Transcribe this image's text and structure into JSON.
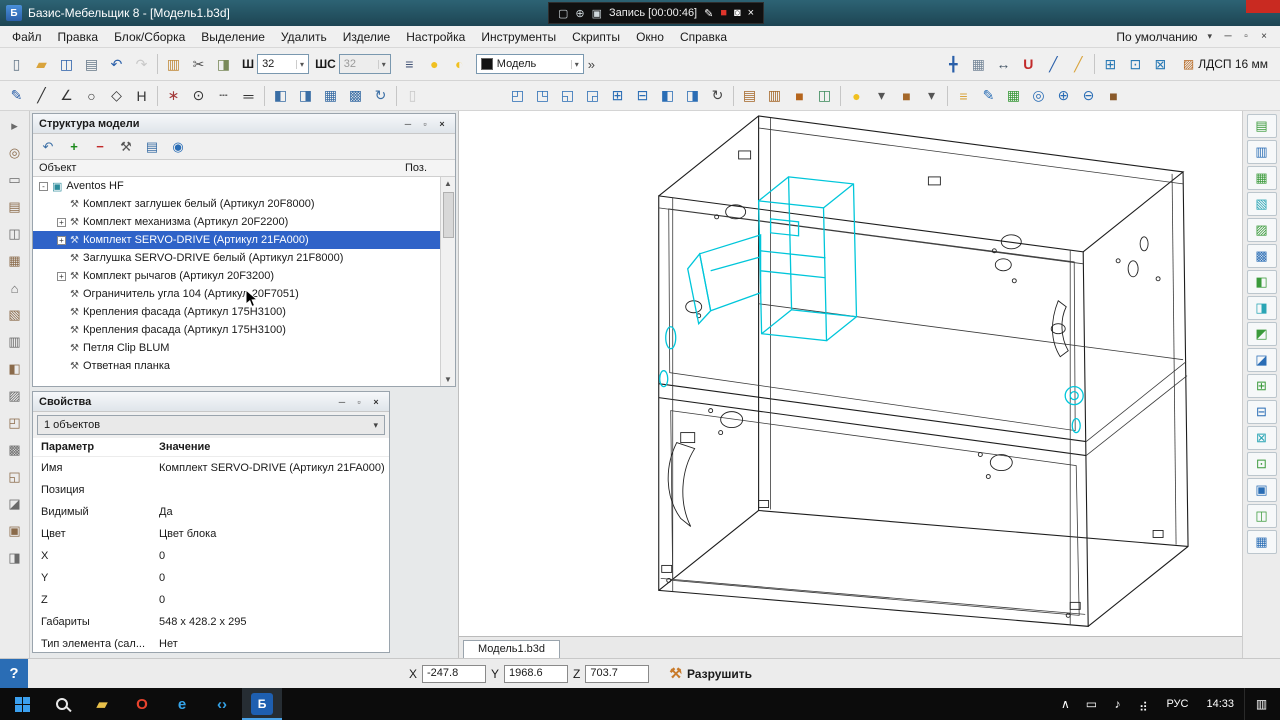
{
  "titlebar": {
    "app_icon_text": "Б",
    "title": "Базис-Мебельщик 8 - [Модель1.b3d]",
    "recorder": {
      "pre_icons": [
        {
          "n": "recorder-display-icon",
          "g": "▢",
          "c": "#cfd8dc"
        },
        {
          "n": "recorder-zoom-icon",
          "g": "⊕",
          "c": "#cfd8dc"
        },
        {
          "n": "recorder-area-icon",
          "g": "▣",
          "c": "#cfd8dc"
        }
      ],
      "label": "Запись [00:00:46]",
      "post_icons": [
        {
          "n": "recorder-pencil-icon",
          "g": "✎",
          "c": "#ffffff"
        },
        {
          "n": "recorder-stop-icon",
          "g": "■",
          "c": "#e0352b"
        },
        {
          "n": "recorder-camera-icon",
          "g": "◙",
          "c": "#ffffff"
        },
        {
          "n": "recorder-close-icon",
          "g": "×",
          "c": "#ffffff"
        }
      ]
    }
  },
  "menubar": {
    "items": [
      "Файл",
      "Правка",
      "Блок/Сборка",
      "Выделение",
      "Удалить",
      "Изделие",
      "Настройка",
      "Инструменты",
      "Скрипты",
      "Окно",
      "Справка"
    ],
    "profile_label": "По умолчанию",
    "profile_arrow": "▾",
    "window_icons": [
      {
        "n": "doc-minimize-icon",
        "g": "─",
        "c": "#333333"
      },
      {
        "n": "doc-restore-icon",
        "g": "▫",
        "c": "#333333"
      },
      {
        "n": "doc-close-icon",
        "g": "×",
        "c": "#333333"
      }
    ]
  },
  "toolbar1": {
    "left_icons": [
      {
        "n": "new-file-icon",
        "g": "▯",
        "c": "#68798a"
      },
      {
        "n": "open-file-icon",
        "g": "▰",
        "c": "#d9a43d"
      },
      {
        "n": "save-icon",
        "g": "◫",
        "c": "#2a5fa9"
      },
      {
        "n": "print-icon",
        "g": "▤",
        "c": "#68798a"
      },
      {
        "n": "undo-icon",
        "g": "↶",
        "c": "#2a5fa9"
      },
      {
        "n": "redo-icon",
        "g": "↷",
        "c": "#999999",
        "dis": true
      },
      {
        "sep": true
      },
      {
        "n": "blocks-icon",
        "g": "▥",
        "c": "#c08a3a"
      },
      {
        "n": "cut-icon",
        "g": "✂",
        "c": "#555555"
      },
      {
        "n": "panel-edit-icon",
        "g": "◨",
        "c": "#7a8a5a"
      }
    ],
    "sh_label": "Ш",
    "sh_value": "32",
    "shs_label": "ШС",
    "shs_value": "32",
    "mid_icons": [
      {
        "n": "layers-icon",
        "g": "≡",
        "c": "#445577"
      },
      {
        "n": "lamp-on-icon",
        "g": "●",
        "c": "#f0c020"
      },
      {
        "n": "lamp-lock-icon",
        "g": "◐",
        "c": "#f0c020"
      }
    ],
    "model_combo": "Модель",
    "overflow": "»",
    "right_icons": [
      {
        "n": "move-icon",
        "g": "╋",
        "c": "#2a5fa9"
      },
      {
        "n": "grid-icon",
        "g": "▦",
        "c": "#778899"
      },
      {
        "n": "dimension-icon",
        "g": "↔",
        "c": "#445566"
      },
      {
        "n": "magnet-icon",
        "g": "U",
        "c": "#c22a2a",
        "bold": true
      },
      {
        "n": "polyline-icon",
        "g": "╱",
        "c": "#2a5fa9"
      },
      {
        "n": "ruler-icon",
        "g": "╱",
        "c": "#d9a43d"
      },
      {
        "sep": true
      },
      {
        "n": "fit-view-icon",
        "g": "⊞",
        "c": "#2a7ab5"
      },
      {
        "n": "pan-view-icon",
        "g": "⊡",
        "c": "#2a7ab5"
      },
      {
        "n": "zoom-window-icon",
        "g": "⊠",
        "c": "#2a7ab5"
      }
    ],
    "material_icon": "▨",
    "material_label": "ЛДСП 16 мм"
  },
  "toolbar2": {
    "left_icons": [
      {
        "n": "spline-tool-icon",
        "g": "✎",
        "c": "#2a5fa9"
      },
      {
        "n": "line-tool-icon",
        "g": "╱",
        "c": "#333333"
      },
      {
        "n": "angle-tool-icon",
        "g": "∠",
        "c": "#333333"
      },
      {
        "n": "circle-tool-icon",
        "g": "○",
        "c": "#333333"
      },
      {
        "n": "polygon-tool-icon",
        "g": "◇",
        "c": "#333333"
      },
      {
        "n": "hdim-tool-icon",
        "g": "H",
        "c": "#333333"
      },
      {
        "sep": true
      },
      {
        "n": "snap-grid-icon",
        "g": "∗",
        "c": "#a33a3a"
      },
      {
        "n": "snap-node-icon",
        "g": "⊙",
        "c": "#333333"
      },
      {
        "n": "trim-icon",
        "g": "┄",
        "c": "#333333"
      },
      {
        "n": "offset-icon",
        "g": "═",
        "c": "#333333"
      },
      {
        "sep": true
      },
      {
        "n": "mirror-h-icon",
        "g": "◧",
        "c": "#3a6ea5"
      },
      {
        "n": "mirror-v-icon",
        "g": "◨",
        "c": "#3a6ea5"
      },
      {
        "n": "array-rect-icon",
        "g": "▦",
        "c": "#3a6ea5"
      },
      {
        "n": "array-polar-icon",
        "g": "▩",
        "c": "#3a6ea5"
      },
      {
        "n": "rotate-icon",
        "g": "↻",
        "c": "#3a6ea5"
      },
      {
        "sep": true
      },
      {
        "n": "sheet-icon",
        "g": "▯",
        "c": "#999999",
        "dis": true
      }
    ],
    "right_icons": [
      {
        "n": "view-front-icon",
        "g": "◰",
        "c": "#2a6db5"
      },
      {
        "n": "view-back-icon",
        "g": "◳",
        "c": "#2a6db5"
      },
      {
        "n": "view-left-icon",
        "g": "◱",
        "c": "#2a6db5"
      },
      {
        "n": "view-right-icon",
        "g": "◲",
        "c": "#2a6db5"
      },
      {
        "n": "view-top-icon",
        "g": "⊞",
        "c": "#2a6db5"
      },
      {
        "n": "view-bottom-icon",
        "g": "⊟",
        "c": "#2a6db5"
      },
      {
        "n": "view-iso-icon",
        "g": "◧",
        "c": "#2a6db5"
      },
      {
        "n": "view-dimetric-icon",
        "g": "◨",
        "c": "#2a6db5"
      },
      {
        "n": "orbit-icon",
        "g": "↻",
        "c": "#444444"
      },
      {
        "sep": true
      },
      {
        "n": "texture-wood-icon",
        "g": "▤",
        "c": "#a5682a"
      },
      {
        "n": "texture-shade-icon",
        "g": "▥",
        "c": "#a5682a"
      },
      {
        "n": "solid-view-icon",
        "g": "■",
        "c": "#b5651d"
      },
      {
        "n": "panel-view-icon",
        "g": "◫",
        "c": "#3a8a5a"
      },
      {
        "sep": true
      },
      {
        "n": "light-icon",
        "g": "●",
        "c": "#f0c020"
      },
      {
        "n": "light-dropdown-icon",
        "g": "▾",
        "c": "#555555"
      },
      {
        "n": "block-mode-icon",
        "g": "■",
        "c": "#a5682a"
      },
      {
        "n": "block-dropdown-icon",
        "g": "▾",
        "c": "#555555"
      },
      {
        "sep": true
      },
      {
        "n": "structure-tree-icon",
        "g": "≡",
        "c": "#d9a43d"
      },
      {
        "n": "edit-pencil-icon",
        "g": "✎",
        "c": "#2a6db5"
      },
      {
        "n": "grid-green-icon",
        "g": "▦",
        "c": "#3a9a3a"
      },
      {
        "n": "find-doc-icon",
        "g": "◎",
        "c": "#2a6db5"
      },
      {
        "n": "zoom-in-icon",
        "g": "⊕",
        "c": "#2a6db5"
      },
      {
        "n": "zoom-out-icon",
        "g": "⊖",
        "c": "#2a6db5"
      },
      {
        "n": "brown-box-icon",
        "g": "■",
        "c": "#8a5a2a"
      }
    ]
  },
  "left_toolbar": {
    "icons": [
      {
        "g": "▸",
        "c": "#6a6a6a"
      },
      {
        "g": "◎",
        "c": "#8a6a4a"
      },
      {
        "g": "▭",
        "c": "#6a6a6a"
      },
      {
        "g": "▤",
        "c": "#8a6a4a"
      },
      {
        "g": "◫",
        "c": "#6a6a6a"
      },
      {
        "g": "▦",
        "c": "#8a6a4a"
      },
      {
        "g": "⌂",
        "c": "#6a6a6a"
      },
      {
        "g": "▧",
        "c": "#8a6a4a"
      },
      {
        "g": "▥",
        "c": "#6a6a6a"
      },
      {
        "g": "◧",
        "c": "#8a6a4a"
      },
      {
        "g": "▨",
        "c": "#6a6a6a"
      },
      {
        "g": "◰",
        "c": "#8a6a4a"
      },
      {
        "g": "▩",
        "c": "#6a6a6a"
      },
      {
        "g": "◱",
        "c": "#8a6a4a"
      },
      {
        "g": "◪",
        "c": "#6a6a6a"
      },
      {
        "g": "▣",
        "c": "#8a6a4a"
      },
      {
        "g": "◨",
        "c": "#6a6a6a"
      }
    ]
  },
  "right_toolbar": {
    "icons": [
      {
        "g": "▤",
        "c": "#3a9a3a"
      },
      {
        "g": "▥",
        "c": "#2a6db5"
      },
      {
        "g": "▦",
        "c": "#3a9a3a"
      },
      {
        "g": "▧",
        "c": "#2aa5b5"
      },
      {
        "g": "▨",
        "c": "#3a9a3a"
      },
      {
        "g": "▩",
        "c": "#2a6db5"
      },
      {
        "g": "◧",
        "c": "#3a9a3a"
      },
      {
        "g": "◨",
        "c": "#2aa5b5"
      },
      {
        "g": "◩",
        "c": "#3a9a3a"
      },
      {
        "g": "◪",
        "c": "#2a6db5"
      },
      {
        "g": "⊞",
        "c": "#3a9a3a"
      },
      {
        "g": "⊟",
        "c": "#2a6db5"
      },
      {
        "g": "⊠",
        "c": "#2aa5b5"
      },
      {
        "g": "⊡",
        "c": "#3a9a3a"
      },
      {
        "g": "▣",
        "c": "#2a6db5"
      },
      {
        "g": "◫",
        "c": "#3a9a3a"
      },
      {
        "g": "▦",
        "c": "#2a6db5"
      }
    ]
  },
  "panel_buttons": [
    {
      "n": "panel-minimize-icon",
      "g": "─",
      "c": "#333333"
    },
    {
      "n": "panel-float-icon",
      "g": "▫",
      "c": "#333333"
    },
    {
      "n": "panel-close-icon",
      "g": "×",
      "c": "#333333"
    }
  ],
  "structure_panel": {
    "title": "Структура модели",
    "toolbar_icons": [
      {
        "n": "tree-undo-icon",
        "g": "↶",
        "c": "#3a6ea5"
      },
      {
        "n": "tree-add-icon",
        "g": "+",
        "c": "#1a8a1a",
        "bold": true
      },
      {
        "n": "tree-remove-icon",
        "g": "−",
        "c": "#c22a2a",
        "bold": true
      },
      {
        "n": "tree-tools-icon",
        "g": "⚒",
        "c": "#555555"
      },
      {
        "n": "tree-report-icon",
        "g": "▤",
        "c": "#3a6ea5"
      },
      {
        "n": "tree-visibility-icon",
        "g": "◉",
        "c": "#2a6db5"
      }
    ],
    "columns": {
      "object": "Объект",
      "pos": "Поз."
    },
    "root": {
      "label": "Aventos HF"
    },
    "items": [
      {
        "label": "Комплект заглушек белый (Артикул 20F8000)",
        "expand": false,
        "selected": false
      },
      {
        "label": "Комплект механизма (Артикул 20F2200)",
        "expand": true,
        "selected": false
      },
      {
        "label": "Комплект SERVO-DRIVE (Артикул 21FA000)",
        "expand": true,
        "selected": true
      },
      {
        "label": "Заглушка SERVO-DRIVE белый (Артикул 21F8000)",
        "expand": false,
        "selected": false
      },
      {
        "label": "Комплект рычагов (Артикул 20F3200)",
        "expand": true,
        "selected": false
      },
      {
        "label": "Ограничитель угла 104 (Артикул 20F7051)",
        "expand": false,
        "selected": false
      },
      {
        "label": "Крепления фасада (Артикул 175H3100)",
        "expand": false,
        "selected": false
      },
      {
        "label": "Крепления фасада (Артикул 175H3100)",
        "expand": false,
        "selected": false
      },
      {
        "label": "Петля Clip BLUM",
        "expand": false,
        "selected": false
      },
      {
        "label": "Ответная планка",
        "expand": false,
        "selected": false
      }
    ]
  },
  "properties_panel": {
    "title": "Свойства",
    "selector": "1 объектов",
    "columns": {
      "param": "Параметр",
      "value": "Значение"
    },
    "rows": [
      {
        "param": "Имя",
        "value": "Комплект SERVO-DRIVE (Артикул 21FA000)"
      },
      {
        "param": "Позиция",
        "value": ""
      },
      {
        "param": "Видимый",
        "value": "Да"
      },
      {
        "param": "Цвет",
        "value": "Цвет блока"
      },
      {
        "param": "X",
        "value": "0"
      },
      {
        "param": "Y",
        "value": "0"
      },
      {
        "param": "Z",
        "value": "0"
      },
      {
        "param": "Габариты",
        "value": "548 x 428.2 x 295"
      },
      {
        "param": "Тип элемента (сал...",
        "value": "Нет"
      }
    ]
  },
  "viewport": {
    "tab": "Модель1.b3d"
  },
  "statusbar": {
    "help_glyph": "?",
    "x_label": "X",
    "x_value": "-247.8",
    "y_label": "Y",
    "y_value": "1968.6",
    "z_label": "Z",
    "z_value": "703.7",
    "destroy_icon": "⚒",
    "destroy_label": "Разрушить"
  },
  "taskbar": {
    "apps": [
      {
        "n": "file-explorer-icon",
        "g": "▰",
        "c": "#e8c04a"
      },
      {
        "n": "opera-browser-icon",
        "g": "O",
        "c": "#e8432d",
        "bold": true
      },
      {
        "n": "edge-browser-icon",
        "g": "e",
        "c": "#35a3e8",
        "bold": true
      },
      {
        "n": "vscode-icon",
        "g": "‹›",
        "c": "#35a3e8",
        "bold": true
      },
      {
        "n": "bazis-app-icon",
        "g": "Б",
        "c": "#ffffff",
        "bg": "#1e5fb0",
        "active": true
      }
    ],
    "tray": [
      {
        "n": "tray-expand-icon",
        "g": "∧",
        "c": "#ffffff"
      },
      {
        "n": "tray-display-icon",
        "g": "▭",
        "c": "#ffffff"
      },
      {
        "n": "tray-volume-icon",
        "g": "♪",
        "c": "#ffffff"
      },
      {
        "n": "tray-network-icon",
        "g": "⣴",
        "c": "#ffffff"
      }
    ],
    "lang": "РУС",
    "time": "14:33",
    "notification_icon": "▥"
  }
}
